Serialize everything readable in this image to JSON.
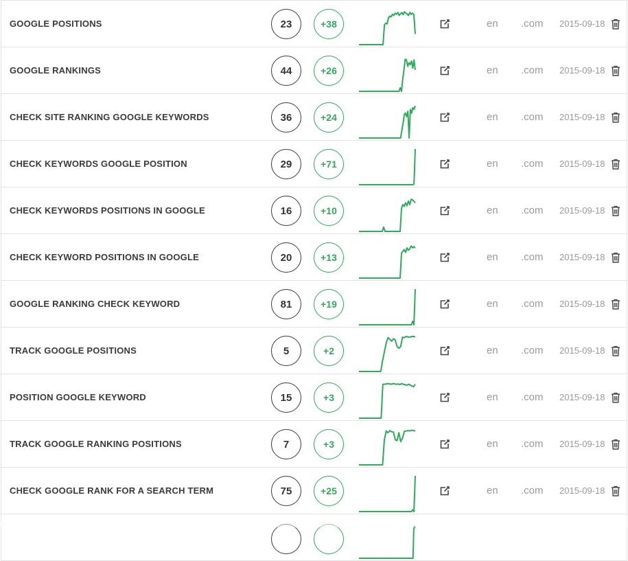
{
  "keywords": [
    {
      "keyword": "GOOGLE POSITIONS",
      "position": "23",
      "change": "+38",
      "trend": [
        0,
        0,
        0,
        0,
        0,
        0,
        0,
        0,
        0,
        0,
        0,
        0,
        0,
        0,
        0,
        0,
        0,
        0,
        0,
        55,
        60,
        58,
        75,
        80,
        78,
        85,
        82,
        88,
        85,
        90,
        82,
        86,
        90,
        84,
        92,
        88,
        86,
        82,
        90,
        85,
        88,
        84,
        30
      ],
      "language": "en",
      "domain": ".com",
      "date": "2015-09-18"
    },
    {
      "keyword": "GOOGLE RANKINGS",
      "position": "44",
      "change": "+26",
      "trend": [
        0,
        0,
        0,
        0,
        0,
        0,
        0,
        0,
        0,
        0,
        0,
        0,
        0,
        0,
        0,
        0,
        0,
        0,
        0,
        0,
        0,
        0,
        0,
        0,
        0,
        0,
        0,
        0,
        0,
        0,
        0,
        0,
        0,
        10,
        0,
        35,
        60,
        90,
        88,
        70,
        80,
        75,
        85,
        65,
        88,
        60
      ],
      "language": "en",
      "domain": ".com",
      "date": "2015-09-18"
    },
    {
      "keyword": "CHECK SITE RANKING GOOGLE KEYWORDS",
      "position": "36",
      "change": "+24",
      "trend": [
        0,
        0,
        0,
        0,
        0,
        0,
        0,
        0,
        0,
        0,
        0,
        0,
        0,
        0,
        0,
        0,
        0,
        0,
        0,
        0,
        0,
        0,
        0,
        0,
        0,
        0,
        0,
        0,
        0,
        0,
        0,
        0,
        0,
        0,
        0,
        20,
        40,
        65,
        70,
        60,
        75,
        0,
        80,
        70,
        85,
        80,
        90
      ],
      "language": "en",
      "domain": ".com",
      "date": "2015-09-18"
    },
    {
      "keyword": "CHECK KEYWORDS GOOGLE POSITION",
      "position": "29",
      "change": "+71",
      "trend": [
        0,
        0,
        0,
        0,
        0,
        0,
        0,
        0,
        0,
        0,
        0,
        0,
        0,
        0,
        0,
        0,
        0,
        0,
        0,
        0,
        0,
        0,
        0,
        0,
        0,
        0,
        0,
        0,
        0,
        0,
        0,
        0,
        0,
        0,
        0,
        0,
        0,
        0,
        0,
        0,
        0,
        0,
        0,
        0,
        2,
        100
      ],
      "language": "en",
      "domain": ".com",
      "date": "2015-09-18"
    },
    {
      "keyword": "CHECK KEYWORDS POSITIONS IN GOOGLE",
      "position": "16",
      "change": "+10",
      "trend": [
        0,
        0,
        0,
        0,
        0,
        0,
        0,
        0,
        0,
        0,
        0,
        0,
        0,
        0,
        0,
        0,
        0,
        0,
        12,
        0,
        0,
        0,
        0,
        0,
        0,
        0,
        0,
        0,
        0,
        0,
        0,
        65,
        75,
        70,
        80,
        72,
        85,
        75,
        90,
        88,
        85,
        80
      ],
      "language": "en",
      "domain": ".com",
      "date": "2015-09-18"
    },
    {
      "keyword": "CHECK KEYWORD POSITIONS IN GOOGLE",
      "position": "20",
      "change": "+13",
      "trend": [
        0,
        0,
        0,
        0,
        0,
        0,
        0,
        0,
        0,
        0,
        0,
        0,
        0,
        0,
        0,
        0,
        0,
        0,
        0,
        0,
        0,
        0,
        0,
        0,
        0,
        0,
        0,
        0,
        0,
        0,
        0,
        70,
        75,
        80,
        72,
        85,
        78,
        82,
        90,
        85,
        88,
        84
      ],
      "language": "en",
      "domain": ".com",
      "date": "2015-09-18"
    },
    {
      "keyword": "GOOGLE RANKING CHECK KEYWORD",
      "position": "81",
      "change": "+19",
      "trend": [
        0,
        0,
        0,
        0,
        0,
        0,
        0,
        0,
        0,
        0,
        0,
        0,
        0,
        0,
        0,
        0,
        0,
        0,
        0,
        0,
        0,
        0,
        0,
        0,
        0,
        0,
        0,
        0,
        0,
        0,
        0,
        0,
        0,
        0,
        0,
        0,
        0,
        0,
        0,
        0,
        0,
        0,
        10,
        0,
        100
      ],
      "language": "en",
      "domain": ".com",
      "date": "2015-09-18"
    },
    {
      "keyword": "TRACK GOOGLE POSITIONS",
      "position": "5",
      "change": "+2",
      "trend": [
        0,
        0,
        0,
        0,
        0,
        0,
        0,
        0,
        0,
        0,
        0,
        0,
        0,
        30,
        55,
        80,
        95,
        90,
        85,
        92,
        88,
        70,
        65,
        70,
        96,
        95,
        98,
        97,
        96,
        98,
        98,
        97
      ],
      "language": "en",
      "domain": ".com",
      "date": "2015-09-18"
    },
    {
      "keyword": "POSITION GOOGLE KEYWORD",
      "position": "15",
      "change": "+3",
      "trend": [
        0,
        0,
        0,
        0,
        0,
        0,
        0,
        0,
        0,
        0,
        0,
        0,
        0,
        0,
        95,
        95,
        96,
        97,
        96,
        95,
        97,
        96,
        95,
        96,
        94,
        97,
        95,
        94,
        92,
        95,
        93,
        90,
        88,
        95
      ],
      "language": "en",
      "domain": ".com",
      "date": "2015-09-18"
    },
    {
      "keyword": "TRACK GOOGLE RANKING POSITIONS",
      "position": "7",
      "change": "+3",
      "trend": [
        0,
        0,
        0,
        0,
        0,
        0,
        0,
        0,
        0,
        0,
        0,
        0,
        0,
        0,
        70,
        95,
        90,
        96,
        93,
        92,
        70,
        68,
        90,
        65,
        75,
        94,
        95,
        96,
        95,
        97,
        96,
        95
      ],
      "language": "en",
      "domain": ".com",
      "date": "2015-09-18"
    },
    {
      "keyword": "CHECK GOOGLE RANK FOR A SEARCH TERM",
      "position": "75",
      "change": "+25",
      "trend": [
        0,
        0,
        0,
        0,
        0,
        0,
        0,
        0,
        0,
        0,
        0,
        0,
        0,
        0,
        0,
        0,
        0,
        0,
        0,
        0,
        0,
        0,
        0,
        0,
        0,
        0,
        0,
        0,
        0,
        0,
        0,
        0,
        0,
        0,
        0,
        0,
        0,
        0,
        0,
        0,
        0,
        0,
        5,
        0,
        100
      ],
      "language": "en",
      "domain": ".com",
      "date": "2015-09-18"
    },
    {
      "keyword": "",
      "position": "",
      "change": "",
      "trend": [
        0,
        0,
        0,
        0,
        0,
        0,
        0,
        0,
        0,
        0,
        0,
        0,
        0,
        0,
        0,
        0,
        0,
        0,
        0,
        0,
        0,
        0,
        0,
        0,
        0,
        0,
        0,
        0,
        0,
        0,
        0,
        0,
        0,
        0,
        0,
        0,
        0,
        0,
        0,
        0,
        0,
        0,
        0,
        0,
        0,
        0,
        0,
        0,
        0,
        0,
        0,
        0,
        0,
        0,
        0,
        0,
        0,
        0,
        0,
        0,
        0,
        0,
        0,
        0,
        0,
        0,
        0,
        0,
        0,
        0,
        0,
        0,
        0,
        80,
        90,
        85
      ],
      "language": "",
      "domain": "",
      "date": ""
    }
  ],
  "colors": {
    "accent": "#2daa5a",
    "text": "#3a3a3a",
    "muted": "#999999",
    "border": "#e2e2e2"
  },
  "icons": {
    "open": "external-link-icon",
    "delete": "trash-icon"
  }
}
